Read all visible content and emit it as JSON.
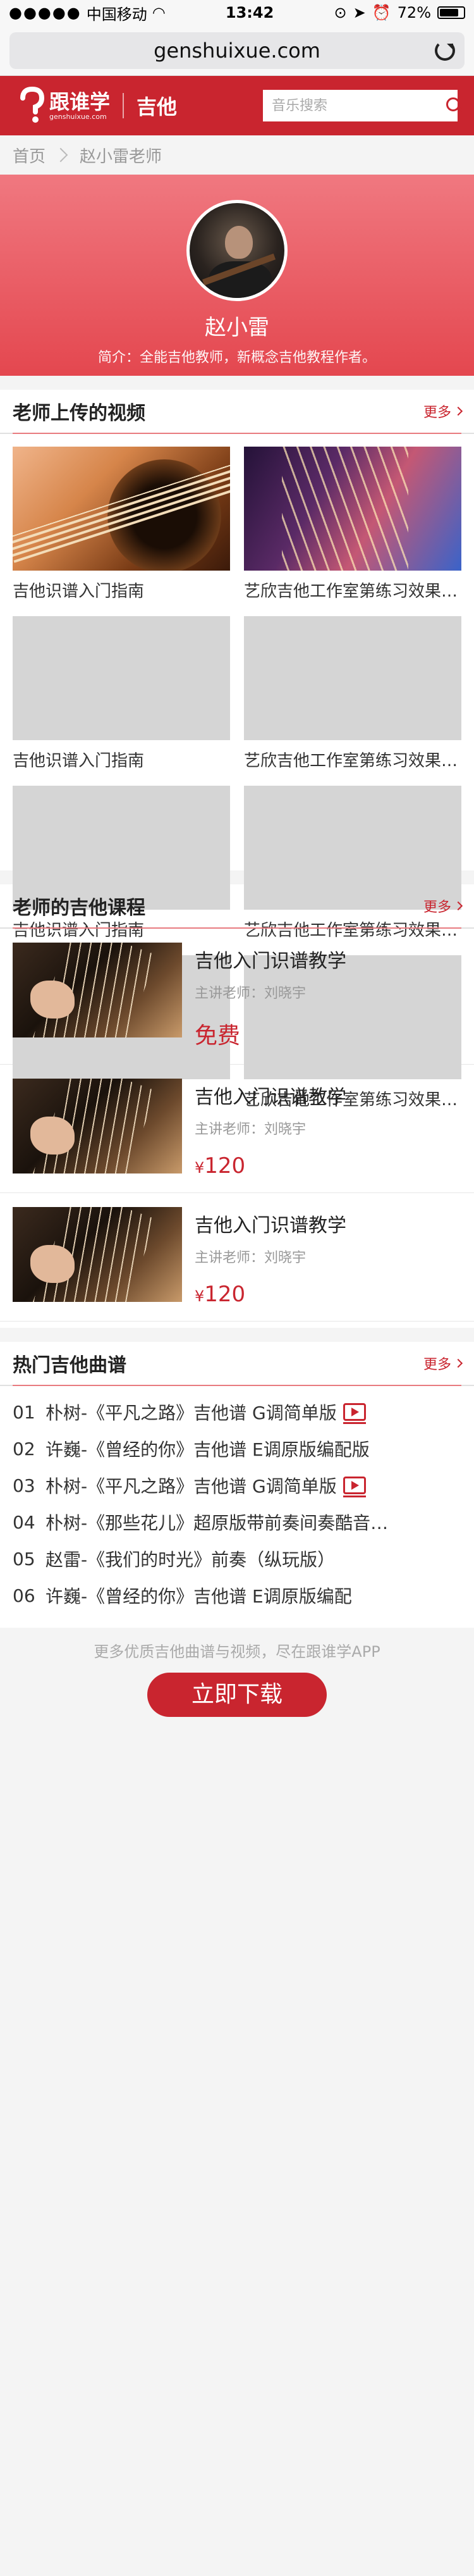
{
  "statusbar": {
    "carrier": "中国移动",
    "time": "13:42",
    "battery": "72%",
    "signal_dots": "●●●●●"
  },
  "browser": {
    "url": "genshuixue.com"
  },
  "header": {
    "logo_cn": "跟谁学",
    "logo_en": "genshuixue.com",
    "category": "吉他",
    "search_placeholder": "音乐搜索"
  },
  "breadcrumb": {
    "home": "首页",
    "current": "赵小雷老师"
  },
  "profile": {
    "name": "赵小雷",
    "intro": "简介：全能吉他教师，新概念吉他教程作者。"
  },
  "videos": {
    "title": "老师上传的视频",
    "more": "更多",
    "items": [
      {
        "title": "吉他识谱入门指南"
      },
      {
        "title": "艺欣吉他工作室第练习效果展示"
      },
      {
        "title": "吉他识谱入门指南"
      },
      {
        "title": "艺欣吉他工作室第练习效果展示"
      },
      {
        "title": "吉他识谱入门指南"
      },
      {
        "title": "艺欣吉他工作室第练习效果展示"
      },
      {
        "title": "吉他识谱入门指南"
      },
      {
        "title": "艺欣吉他工作室第练习效果展示"
      }
    ]
  },
  "courses": {
    "title": "老师的吉他课程",
    "more": "更多",
    "items": [
      {
        "title": "吉他入门识谱教学",
        "teacher": "主讲老师：刘晓宇",
        "price": "免费",
        "currency": ""
      },
      {
        "title": "吉他入门识谱教学",
        "teacher": "主讲老师：刘晓宇",
        "price": "120",
        "currency": "¥"
      },
      {
        "title": "吉他入门识谱教学",
        "teacher": "主讲老师：刘晓宇",
        "price": "120",
        "currency": "¥"
      }
    ]
  },
  "songs": {
    "title": "热门吉他曲谱",
    "more": "更多",
    "items": [
      {
        "no": "01",
        "text": "朴树-《平凡之路》吉他谱 G调简单版",
        "video": true
      },
      {
        "no": "02",
        "text": "许巍-《曾经的你》吉他谱 E调原版编配版",
        "video": false
      },
      {
        "no": "03",
        "text": "朴树-《平凡之路》吉他谱 G调简单版",
        "video": true
      },
      {
        "no": "04",
        "text": "朴树-《那些花儿》超原版带前奏间奏酷音小样编配",
        "video": false
      },
      {
        "no": "05",
        "text": "赵雷-《我们的时光》前奏（纵玩版）",
        "video": false
      },
      {
        "no": "06",
        "text": "许巍-《曾经的你》吉他谱 E调原版编配",
        "video": false
      }
    ]
  },
  "footer": {
    "note": "更多优质吉他曲谱与视频，尽在跟谁学APP",
    "download": "立即下载"
  },
  "colors": {
    "brand": "#c9252f",
    "profile_bg": "#e4474f",
    "page_bg": "#f4f4f4"
  }
}
